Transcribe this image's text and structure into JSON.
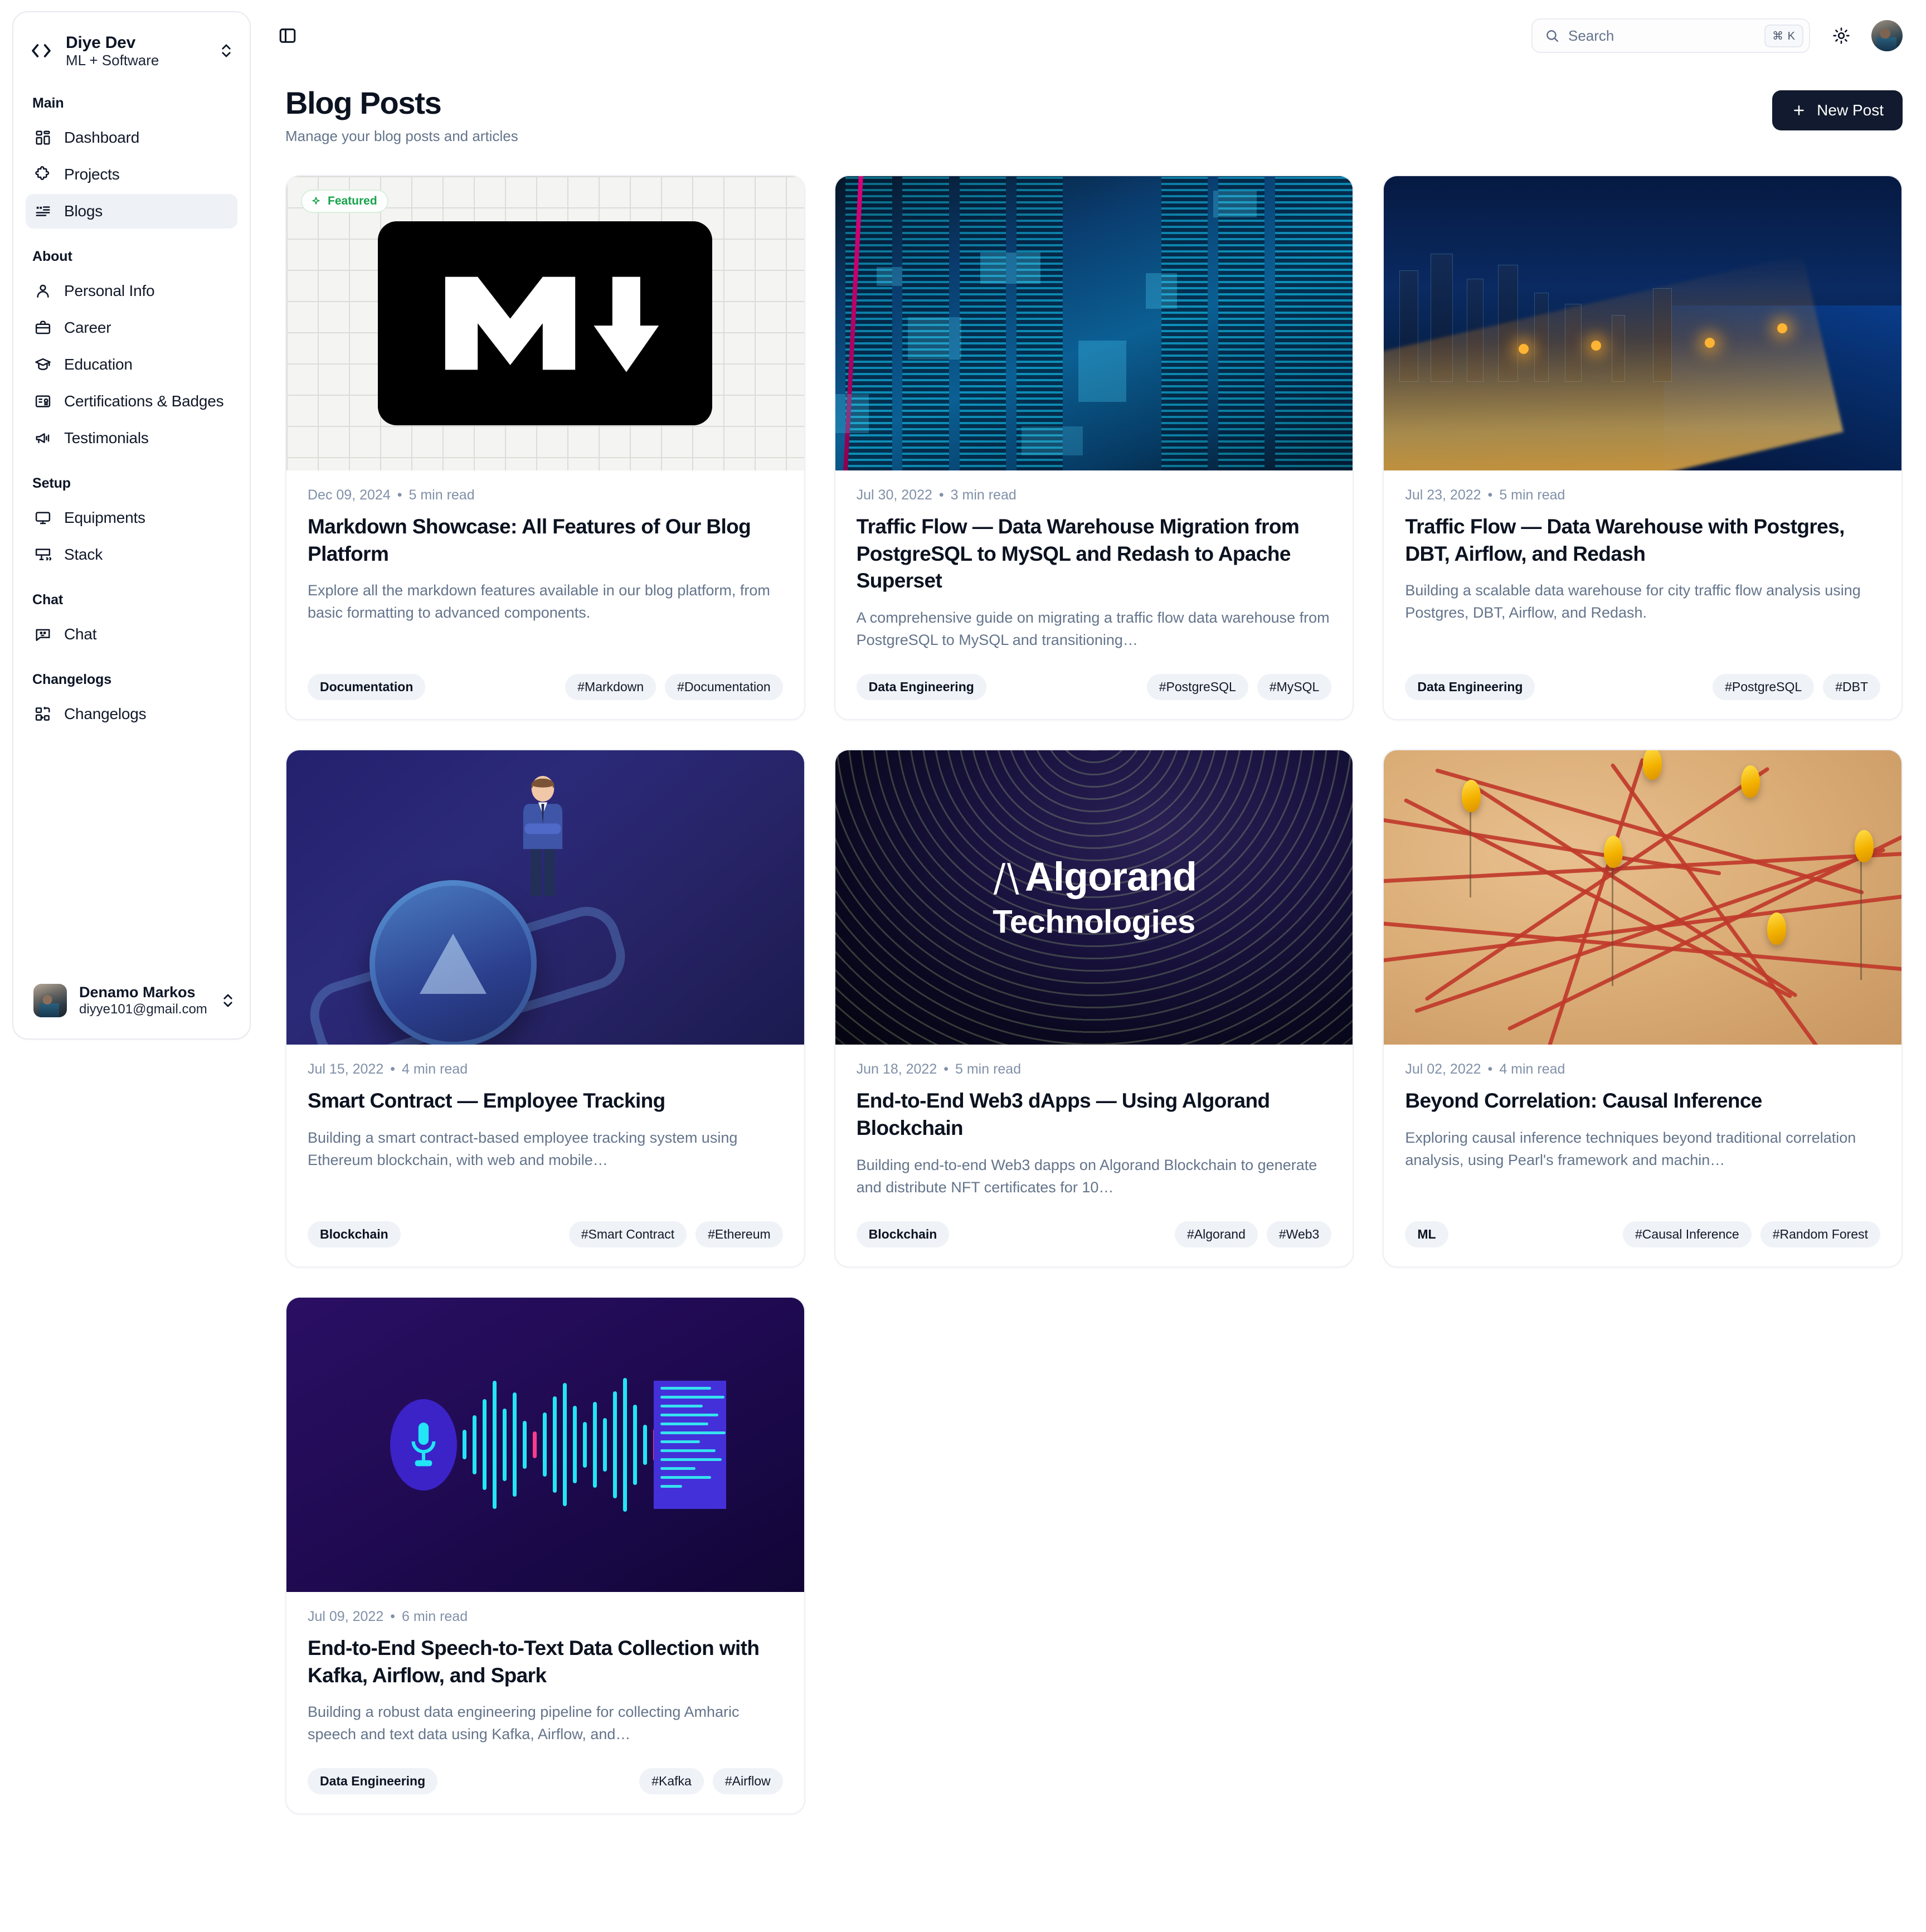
{
  "sidebar": {
    "brand": {
      "name": "Diye Dev",
      "subtitle": "ML + Software",
      "logo_icon": "code-brackets-icon"
    },
    "groups": [
      {
        "label": "Main",
        "items": [
          {
            "label": "Dashboard",
            "icon": "layout-dashboard-icon",
            "active": false
          },
          {
            "label": "Projects",
            "icon": "puzzle-piece-icon",
            "active": false
          },
          {
            "label": "Blogs",
            "icon": "quote-list-icon",
            "active": true
          }
        ]
      },
      {
        "label": "About",
        "items": [
          {
            "label": "Personal Info",
            "icon": "user-icon",
            "active": false
          },
          {
            "label": "Career",
            "icon": "briefcase-icon",
            "active": false
          },
          {
            "label": "Education",
            "icon": "graduation-cap-icon",
            "active": false
          },
          {
            "label": "Certifications & Badges",
            "icon": "certificate-icon",
            "active": false
          },
          {
            "label": "Testimonials",
            "icon": "megaphone-icon",
            "active": false
          }
        ]
      },
      {
        "label": "Setup",
        "items": [
          {
            "label": "Equipments",
            "icon": "monitor-icon",
            "active": false
          },
          {
            "label": "Stack",
            "icon": "monitor-code-icon",
            "active": false
          }
        ]
      },
      {
        "label": "Chat",
        "items": [
          {
            "label": "Chat",
            "icon": "chat-smile-icon",
            "active": false
          }
        ]
      },
      {
        "label": "Changelogs",
        "items": [
          {
            "label": "Changelogs",
            "icon": "changelog-icon",
            "active": false
          }
        ]
      }
    ],
    "user": {
      "name": "Denamo Markos",
      "email": "diyye101@gmail.com"
    }
  },
  "topbar": {
    "panel_toggle_icon": "sidebar-toggle-icon",
    "search": {
      "placeholder": "Search",
      "icon": "search-icon",
      "shortcut": "⌘ K"
    },
    "theme_toggle_icon": "sun-icon",
    "avatar_icon": "user-avatar"
  },
  "page": {
    "title": "Blog Posts",
    "subtitle": "Manage your blog posts and articles",
    "new_post_label": "New Post",
    "new_post_icon": "plus-icon"
  },
  "colors": {
    "accent_dark": "#111a2e",
    "featured_green": "#16a34a",
    "muted_text": "#64748b",
    "chip_bg": "#eff2f7",
    "active_nav_bg": "#eef1f6"
  },
  "posts": [
    {
      "featured": true,
      "featured_label": "Featured",
      "date": "Dec 09, 2024",
      "read_time": "5 min read",
      "title": "Markdown Showcase: All Features of Our Blog Platform",
      "description": "Explore all the markdown features available in our blog platform, from basic formatting to advanced components.",
      "category": "Documentation",
      "tags": [
        "#Markdown",
        "#Documentation"
      ],
      "art": "markdown-logo-thumbnail"
    },
    {
      "featured": false,
      "date": "Jul 30, 2022",
      "read_time": "3 min read",
      "title": "Traffic Flow — Data Warehouse Migration from PostgreSQL to MySQL and Redash to Apache Superset",
      "description": "A comprehensive guide on migrating a traffic flow data warehouse from PostgreSQL to MySQL and transitioning…",
      "category": "Data Engineering",
      "tags": [
        "#PostgreSQL",
        "#MySQL"
      ],
      "art": "datacenter-thumbnail"
    },
    {
      "featured": false,
      "date": "Jul 23, 2022",
      "read_time": "5 min read",
      "title": "Traffic Flow — Data Warehouse with Postgres, DBT, Airflow, and Redash",
      "description": "Building a scalable data warehouse for city traffic flow analysis using Postgres, DBT, Airflow, and Redash.",
      "category": "Data Engineering",
      "tags": [
        "#PostgreSQL",
        "#DBT"
      ],
      "art": "city-traffic-night-thumbnail"
    },
    {
      "featured": false,
      "date": "Jul 15, 2022",
      "read_time": "4 min read",
      "title": "Smart Contract — Employee Tracking",
      "description": "Building a smart contract-based employee tracking system using Ethereum blockchain, with web and mobile…",
      "category": "Blockchain",
      "tags": [
        "#Smart Contract",
        "#Ethereum"
      ],
      "art": "ethereum-coin-thumbnail"
    },
    {
      "featured": false,
      "date": "Jun 18, 2022",
      "read_time": "5 min read",
      "title": "End-to-End Web3 dApps — Using Algorand Blockchain",
      "description": "Building end-to-end Web3 dapps on Algorand Blockchain to generate and distribute NFT certificates for 10…",
      "category": "Blockchain",
      "tags": [
        "#Algorand",
        "#Web3"
      ],
      "art": "algorand-logo-thumbnail",
      "art_text": {
        "name": "Algorand",
        "sub": "Technologies"
      }
    },
    {
      "featured": false,
      "date": "Jul 02, 2022",
      "read_time": "4 min read",
      "title": "Beyond Correlation: Causal Inference",
      "description": "Exploring causal inference techniques beyond traditional correlation analysis, using Pearl's framework and machin…",
      "category": "ML",
      "tags": [
        "#Causal Inference",
        "#Random Forest"
      ],
      "art": "pins-network-thumbnail"
    },
    {
      "featured": false,
      "date": "Jul 09, 2022",
      "read_time": "6 min read",
      "title": "End-to-End Speech-to-Text Data Collection with Kafka, Airflow, and Spark",
      "description": "Building a robust data engineering pipeline for collecting Amharic speech and text data using Kafka, Airflow, and…",
      "category": "Data Engineering",
      "tags": [
        "#Kafka",
        "#Airflow"
      ],
      "art": "speech-waveform-thumbnail"
    }
  ]
}
